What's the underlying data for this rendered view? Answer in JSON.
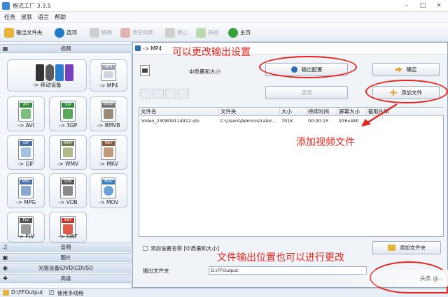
{
  "window": {
    "title": "格式工厂 3.3.5",
    "controls": [
      "–",
      "□",
      "×"
    ]
  },
  "menu": [
    "任务",
    "皮肤",
    "语言",
    "帮助"
  ],
  "toolbar": [
    {
      "label": "输出文件夹",
      "icon": "folder-icon",
      "color": "#e8b23a",
      "disabled": false
    },
    {
      "label": "选项",
      "icon": "gear-icon",
      "color": "#1f7ac7",
      "disabled": false
    },
    {
      "label": "移除",
      "icon": "remove-icon",
      "color": "#c9c9c9",
      "disabled": true
    },
    {
      "label": "清空列表",
      "icon": "clear-icon",
      "color": "#d8a0a0",
      "disabled": true
    },
    {
      "label": "停止",
      "icon": "stop-icon",
      "color": "#c9c9c9",
      "disabled": true
    },
    {
      "label": "开始",
      "icon": "play-icon",
      "color": "#b7d7a8",
      "disabled": true
    },
    {
      "label": "主页",
      "icon": "home-icon",
      "color": "#38a13c",
      "disabled": false
    }
  ],
  "sidebar": {
    "video_header": "视频",
    "formats": [
      {
        "label": "-> 移动设备",
        "tag": "",
        "color": "#555555"
      },
      {
        "label": "-> MP4",
        "tag": "MP4",
        "color": "#9aa3ad"
      },
      {
        "label": "-> AVI",
        "tag": "AVI",
        "color": "#2f8a3a"
      },
      {
        "label": "-> 3GP",
        "tag": "3GP",
        "color": "#2f8a3a"
      },
      {
        "label": "-> RMVB",
        "tag": "RMVB",
        "color": "#6a6a6a"
      },
      {
        "label": "-> GIF",
        "tag": "GIF",
        "color": "#4a6fa5"
      },
      {
        "label": "-> WMV",
        "tag": "WMV",
        "color": "#6a7a4a"
      },
      {
        "label": "-> MKV",
        "tag": "MKV",
        "color": "#8a5a3a"
      },
      {
        "label": "-> MPG",
        "tag": "MPG",
        "color": "#4a6fa5"
      },
      {
        "label": "-> VOB",
        "tag": "VOB",
        "color": "#555555"
      },
      {
        "label": "-> MOV",
        "tag": "MOV",
        "color": "#3a7abf"
      },
      {
        "label": "-> FLV",
        "tag": "FLV",
        "color": "#555555"
      },
      {
        "label": "-> SWF",
        "tag": "SWF",
        "color": "#c0392b"
      }
    ],
    "categories": [
      "音频",
      "图片",
      "光驱设备\\DVD\\CD\\ISO",
      "高级"
    ]
  },
  "statusbar": {
    "path": "D:\\FFOutput",
    "multithread_label": "使用多线程",
    "multithread_checked": true
  },
  "dialog": {
    "title": "-> MP4",
    "quality": "中质量和大小",
    "output_config_button": "输出配置",
    "ok_button": "确定",
    "options_button": "选项",
    "add_file_button": "添加文件",
    "add_folder_button": "添加文件夹",
    "add_setting_label": "添加设置名称 [中质量和大小]",
    "output_folder_label": "输出文件夹",
    "output_folder_value": "D:\\FFOutput",
    "table": {
      "headers": [
        "文件名",
        "文件夹",
        "大小",
        "持续时间",
        "屏幕大小",
        "截取片断"
      ],
      "rows": [
        {
          "name": "Video_230809114912.qlv",
          "folder": "C:\\Users\\Administrator...",
          "size": "701K",
          "duration": "00:00:15",
          "screen": "976x480",
          "clip": ""
        }
      ]
    }
  },
  "annotations": {
    "config": "可以更改输出设置",
    "add_video": "添加视频文件",
    "output_location": "文件输出位置也可以进行更改"
  },
  "watermark": "头条 @...",
  "accent_red": "#e8251d"
}
